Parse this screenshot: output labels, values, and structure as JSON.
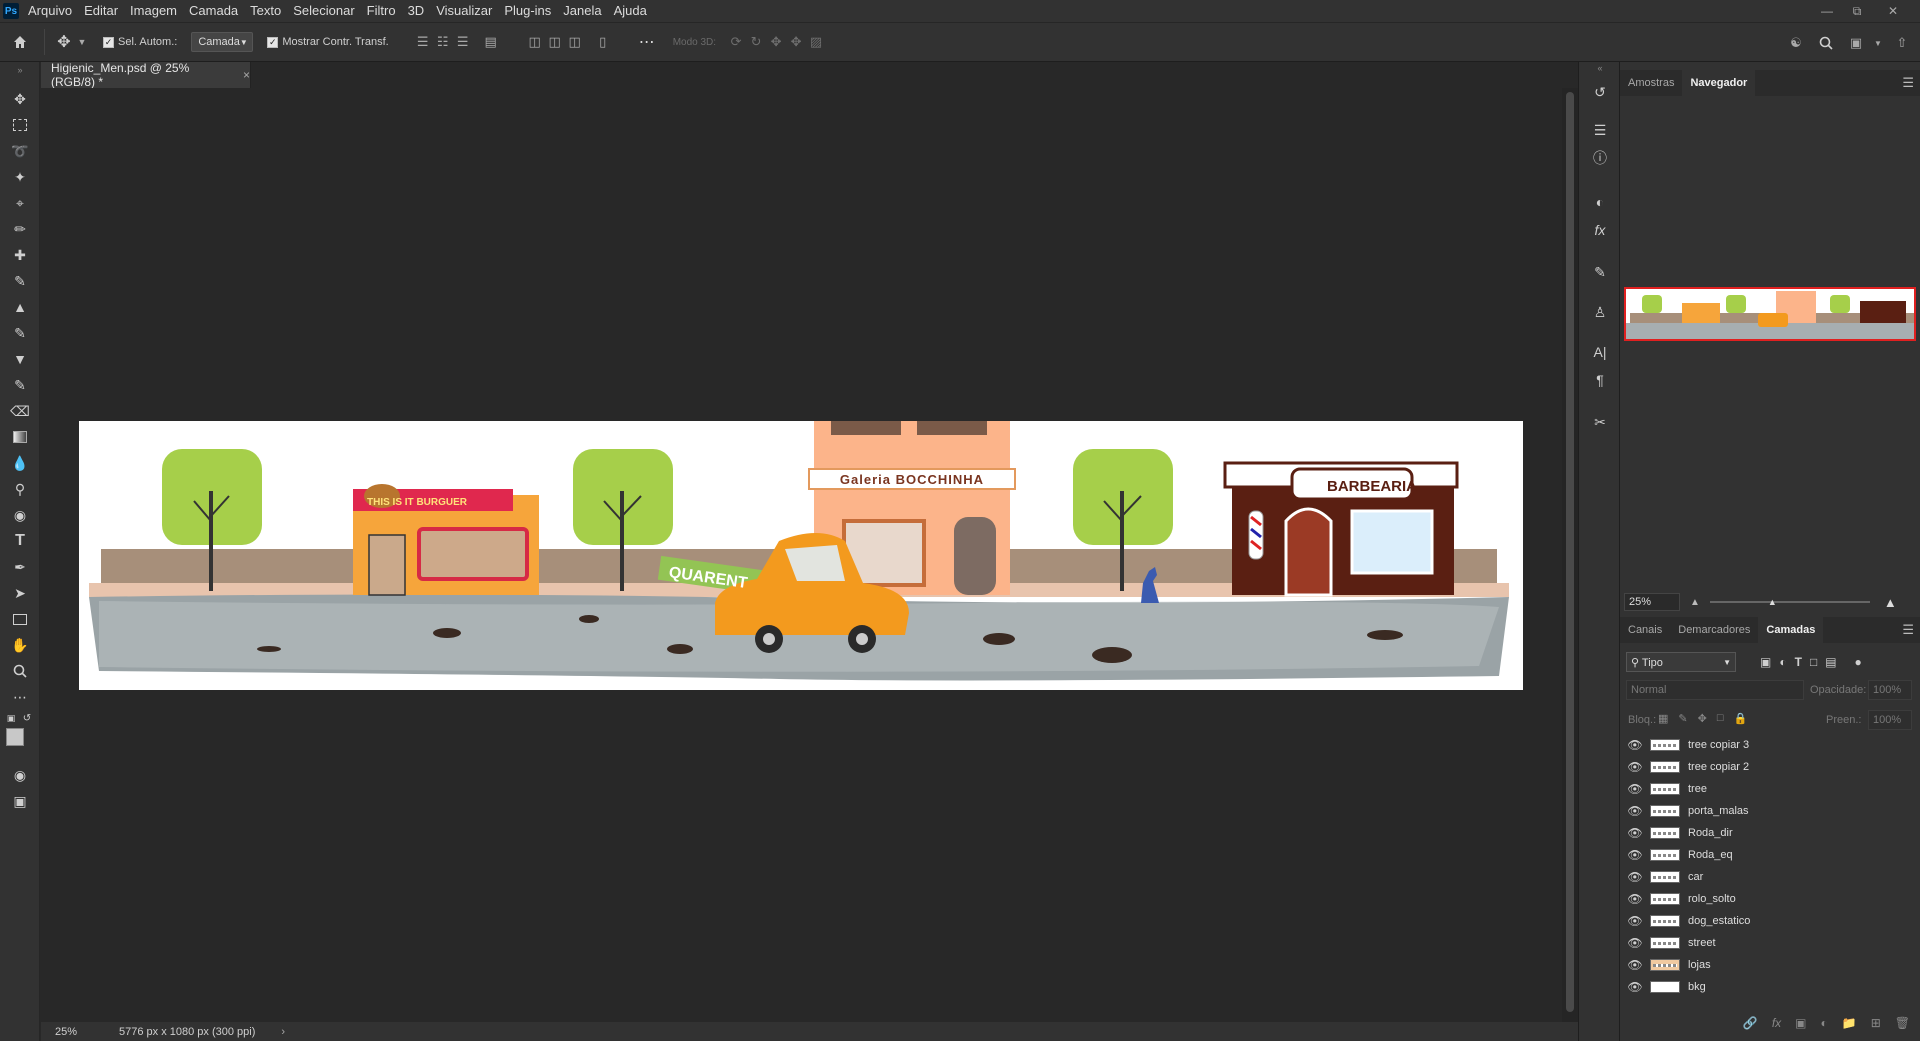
{
  "app": {
    "logo": "Ps"
  },
  "menu": [
    "Arquivo",
    "Editar",
    "Imagem",
    "Camada",
    "Texto",
    "Selecionar",
    "Filtro",
    "3D",
    "Visualizar",
    "Plug-ins",
    "Janela",
    "Ajuda"
  ],
  "options": {
    "auto_select_label": "Sel. Autom.:",
    "auto_select_target": "Camada",
    "show_transform_label": "Mostrar Contr. Transf.",
    "mode3d_label": "Modo 3D:"
  },
  "document": {
    "tab_title": "Higienic_Men.psd @ 25% (RGB/8) *",
    "close_glyph": "×",
    "zoom": "25%",
    "info": "5776 px x 1080 px (300 ppi)"
  },
  "artwork": {
    "burger_sign": "THIS IS IT BURGUER",
    "gallery_sign": "Galeria BOCCHINHA",
    "barber_sign": "BARBEARIA",
    "graffiti": "QUARENT"
  },
  "panels": {
    "top_tabs": [
      "Amostras",
      "Navegador"
    ],
    "top_active": "Navegador",
    "navigator_zoom": "25%",
    "layer_tabs": [
      "Canais",
      "Demarcadores",
      "Camadas"
    ],
    "layer_active": "Camadas",
    "filter_kind": "Tipo",
    "blend_mode": "Normal",
    "opacity_label": "Opacidade:",
    "opacity_value": "100%",
    "lock_label": "Bloq.:",
    "fill_label": "Preen.:",
    "fill_value": "100%"
  },
  "layers": [
    "tree copiar 3",
    "tree copiar 2",
    "tree",
    "porta_malas",
    "Roda_dir",
    "Roda_eq",
    "car",
    "rolo_solto",
    "dog_estatico",
    "street",
    "lojas",
    "bkg"
  ],
  "colors": {
    "accent_red": "#e02020",
    "car_orange": "#f39a1e",
    "tree_green": "#a6cf4a"
  }
}
